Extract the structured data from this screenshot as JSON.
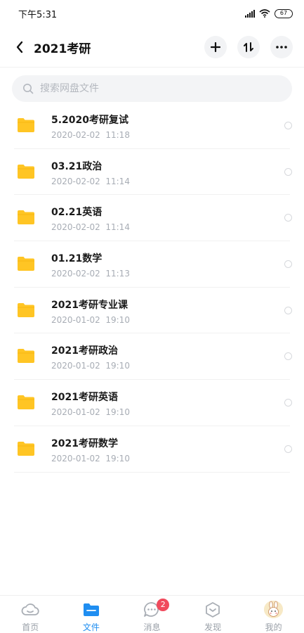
{
  "status_bar": {
    "time": "下午5:31",
    "battery": "67"
  },
  "header": {
    "title": "2021考研"
  },
  "search": {
    "placeholder": "搜索网盘文件"
  },
  "colors": {
    "folder": "#ffc524",
    "accent": "#1f8ef1",
    "badge": "#f04a5c"
  },
  "files": [
    {
      "name": "5.2020考研复试",
      "date": "2020-02-02  11:18",
      "icon": "folder-icon"
    },
    {
      "name": "03.21政治",
      "date": "2020-02-02  11:14",
      "icon": "folder-icon"
    },
    {
      "name": "02.21英语",
      "date": "2020-02-02  11:14",
      "icon": "folder-icon"
    },
    {
      "name": "01.21数学",
      "date": "2020-02-02  11:13",
      "icon": "folder-icon"
    },
    {
      "name": "2021考研专业课",
      "date": "2020-01-02  19:10",
      "icon": "folder-icon"
    },
    {
      "name": "2021考研政治",
      "date": "2020-01-02  19:10",
      "icon": "folder-icon"
    },
    {
      "name": "2021考研英语",
      "date": "2020-01-02  19:10",
      "icon": "folder-icon"
    },
    {
      "name": "2021考研数学",
      "date": "2020-01-02  19:10",
      "icon": "folder-icon"
    }
  ],
  "bottom_nav": {
    "items": [
      {
        "label": "首页",
        "icon": "home-cloud-icon"
      },
      {
        "label": "文件",
        "icon": "folder-icon",
        "active": true
      },
      {
        "label": "消息",
        "icon": "chat-bubble-icon",
        "badge": "2"
      },
      {
        "label": "发现",
        "icon": "discover-cube-icon"
      },
      {
        "label": "我的",
        "icon": "avatar-icon"
      }
    ]
  }
}
